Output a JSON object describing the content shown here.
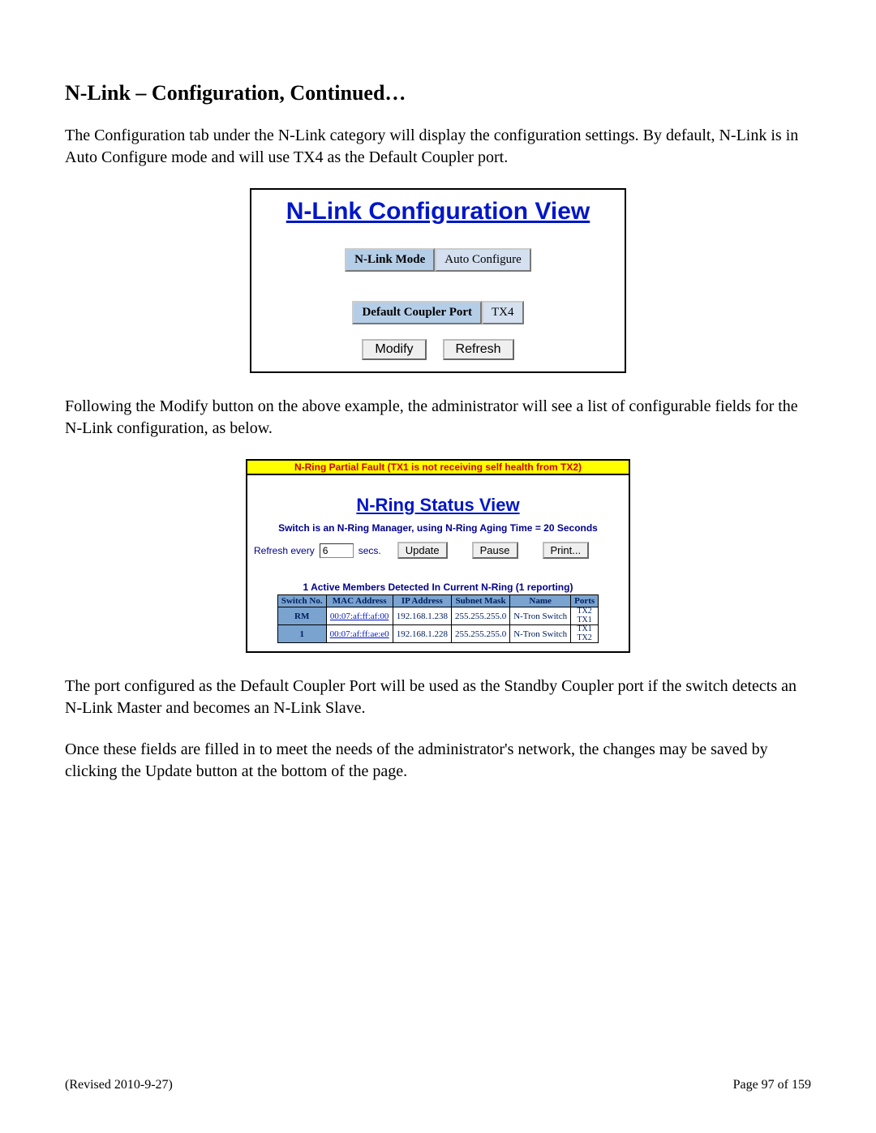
{
  "heading": "N-Link – Configuration, Continued…",
  "para1": "The Configuration tab under the N-Link category will display the configuration settings.  By default, N-Link is in Auto Configure mode and will use TX4 as the Default Coupler port.",
  "fig1": {
    "title": "N-Link Configuration View",
    "mode_label": "N-Link Mode",
    "mode_value": "Auto Configure",
    "coupler_label": "Default Coupler Port",
    "coupler_value": "TX4",
    "modify": "Modify",
    "refresh": "Refresh"
  },
  "para2": "Following the Modify button on the above example, the administrator will see a list of configurable fields for the N-Link configuration, as below.",
  "fig2": {
    "fault": "N-Ring Partial Fault (TX1 is not receiving self health from TX2)",
    "title": "N-Ring Status View",
    "mgr": "Switch is an N-Ring Manager, using N-Ring Aging Time = 20 Seconds",
    "refresh_label": "Refresh every",
    "refresh_value": "6",
    "secs": "secs.",
    "update": "Update",
    "pause": "Pause",
    "print": "Print...",
    "members_line": "1 Active Members Detected In Current N-Ring (1 reporting)",
    "headers": {
      "switch": "Switch No.",
      "mac": "MAC Address",
      "ip": "IP Address",
      "subnet": "Subnet Mask",
      "name": "Name",
      "ports": "Ports"
    },
    "rows": [
      {
        "switch": "RM",
        "mac": "00:07:af:ff:af:00",
        "ip": "192.168.1.238",
        "subnet": "255.255.255.0",
        "name": "N-Tron Switch",
        "port1": "TX2",
        "port2": "TX1"
      },
      {
        "switch": "1",
        "mac": "00:07:af:ff:ae:e0",
        "ip": "192.168.1.228",
        "subnet": "255.255.255.0",
        "name": "N-Tron Switch",
        "port1": "TX1",
        "port2": "TX2"
      }
    ]
  },
  "para3": "The port configured as the Default Coupler Port will be used as the Standby Coupler port if the switch detects an N-Link Master and becomes an N-Link Slave.",
  "para4": "Once these fields are filled in to meet the needs of the administrator's network, the changes may be saved by clicking the Update button at the bottom of the page.",
  "footer": {
    "left": "(Revised 2010-9-27)",
    "right": "Page 97 of 159"
  }
}
